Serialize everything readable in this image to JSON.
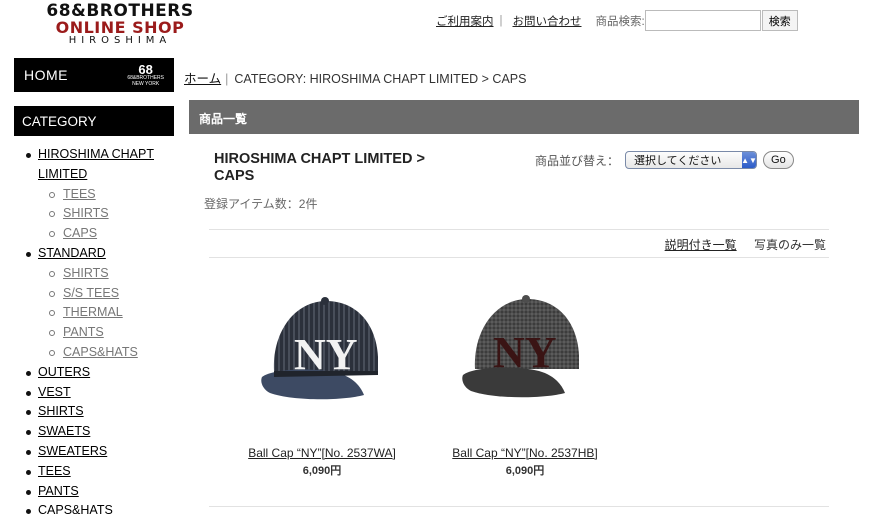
{
  "logo": {
    "line1": "68&BROTHERS",
    "line2": "ONLINE SHOP",
    "line3": "HIROSHIMA"
  },
  "header": {
    "guide_link": "ご利用案内",
    "contact_link": "お問い合わせ",
    "search_label": "商品検索:",
    "search_value": "",
    "search_button": "検索"
  },
  "sidebar": {
    "home_label": "HOME",
    "home_logo_big": "68",
    "home_logo_small": "68&BROTHERS",
    "home_logo_sub": "NEW YORK",
    "category_heading": "CATEGORY",
    "categories": [
      {
        "label": "HIROSHIMA CHAPT LIMITED",
        "children": [
          "TEES",
          "SHIRTS",
          "CAPS"
        ]
      },
      {
        "label": "STANDARD",
        "children": [
          "SHIRTS",
          "S/S TEES",
          "THERMAL",
          "PANTS",
          "CAPS&HATS"
        ]
      },
      {
        "label": "OUTERS",
        "children": []
      },
      {
        "label": "VEST",
        "children": []
      },
      {
        "label": "SHIRTS",
        "children": []
      },
      {
        "label": "SWAETS",
        "children": []
      },
      {
        "label": "SWEATERS",
        "children": []
      },
      {
        "label": "TEES",
        "children": []
      },
      {
        "label": "PANTS",
        "children": []
      },
      {
        "label": "CAPS&HATS",
        "children": []
      }
    ]
  },
  "breadcrumb": {
    "home": "ホーム",
    "current": "CATEGORY: HIROSHIMA CHAPT LIMITED > CAPS"
  },
  "main": {
    "section_title": "商品一覧",
    "category_title": "HIROSHIMA CHAPT LIMITED > CAPS",
    "sort_label": "商品並び替え：",
    "sort_selected": "選択してください",
    "sort_go": "Go",
    "item_count": "登録アイテム数：2件",
    "view_with_desc": "説明付き一覧",
    "view_photos_only": "写真のみ一覧",
    "products": [
      {
        "name": "Ball Cap “NY”[No. 2537WA]",
        "price": "6,090円",
        "cap_color": "#2a2f3a",
        "brim_color": "#3d4a63",
        "text_color": "#f2f2f2"
      },
      {
        "name": "Ball Cap “NY”[No. 2537HB]",
        "price": "6,090円",
        "cap_color": "#4a4a4a",
        "brim_color": "#3a3a3a",
        "text_color": "#3a1414"
      }
    ]
  },
  "colors": {
    "section_bar": "#6b6b6b",
    "logo_red": "#9b1b1b"
  }
}
